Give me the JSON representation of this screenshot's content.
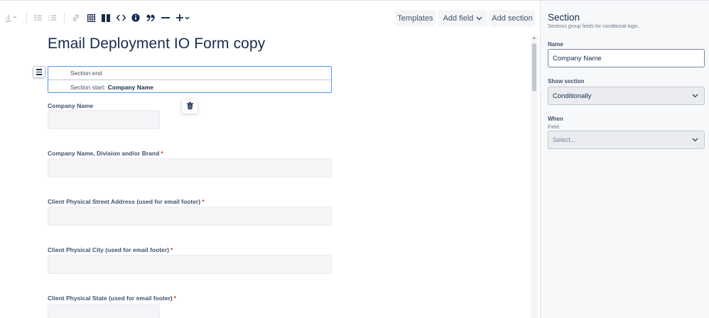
{
  "toolbar": {
    "icons": {
      "text_color": "text-color-icon",
      "bullet_list": "bullet-list-icon",
      "numbered_list": "numbered-list-icon",
      "link": "link-icon",
      "table": "table-icon",
      "layout": "layout-columns-icon",
      "code": "code-icon",
      "info": "info-icon",
      "quote": "quote-icon",
      "divider": "divider-icon",
      "insert": "plus-icon"
    },
    "templates_label": "Templates",
    "add_field_label": "Add field",
    "add_section_label": "Add section"
  },
  "form": {
    "title": "Email Deployment IO Form copy",
    "section_block": {
      "end_label": "Section end",
      "start_label": "Section start:",
      "start_name": "Company Name"
    },
    "fields": [
      {
        "label": "Company Name",
        "required": false
      },
      {
        "label": "Company Name, Division and/or Brand",
        "required": true
      },
      {
        "label": "Client Physical Street Address (used for email footer)",
        "required": true
      },
      {
        "label": "Client Physical City (used for email footer)",
        "required": true
      },
      {
        "label": "Client Physical State (used for email footer)",
        "required": true
      }
    ],
    "required_marker": "*"
  },
  "panel": {
    "title": "Section",
    "subtitle": "Sections group fields for conditional logic.",
    "name_label": "Name",
    "name_value": "Company Name",
    "show_label": "Show section",
    "show_value": "Conditionally",
    "when_label": "When",
    "field_label": "Field:",
    "field_placeholder": "Select..."
  },
  "colors": {
    "accent": "#4c9aff",
    "required": "#de350b",
    "text": "#172b4d"
  }
}
